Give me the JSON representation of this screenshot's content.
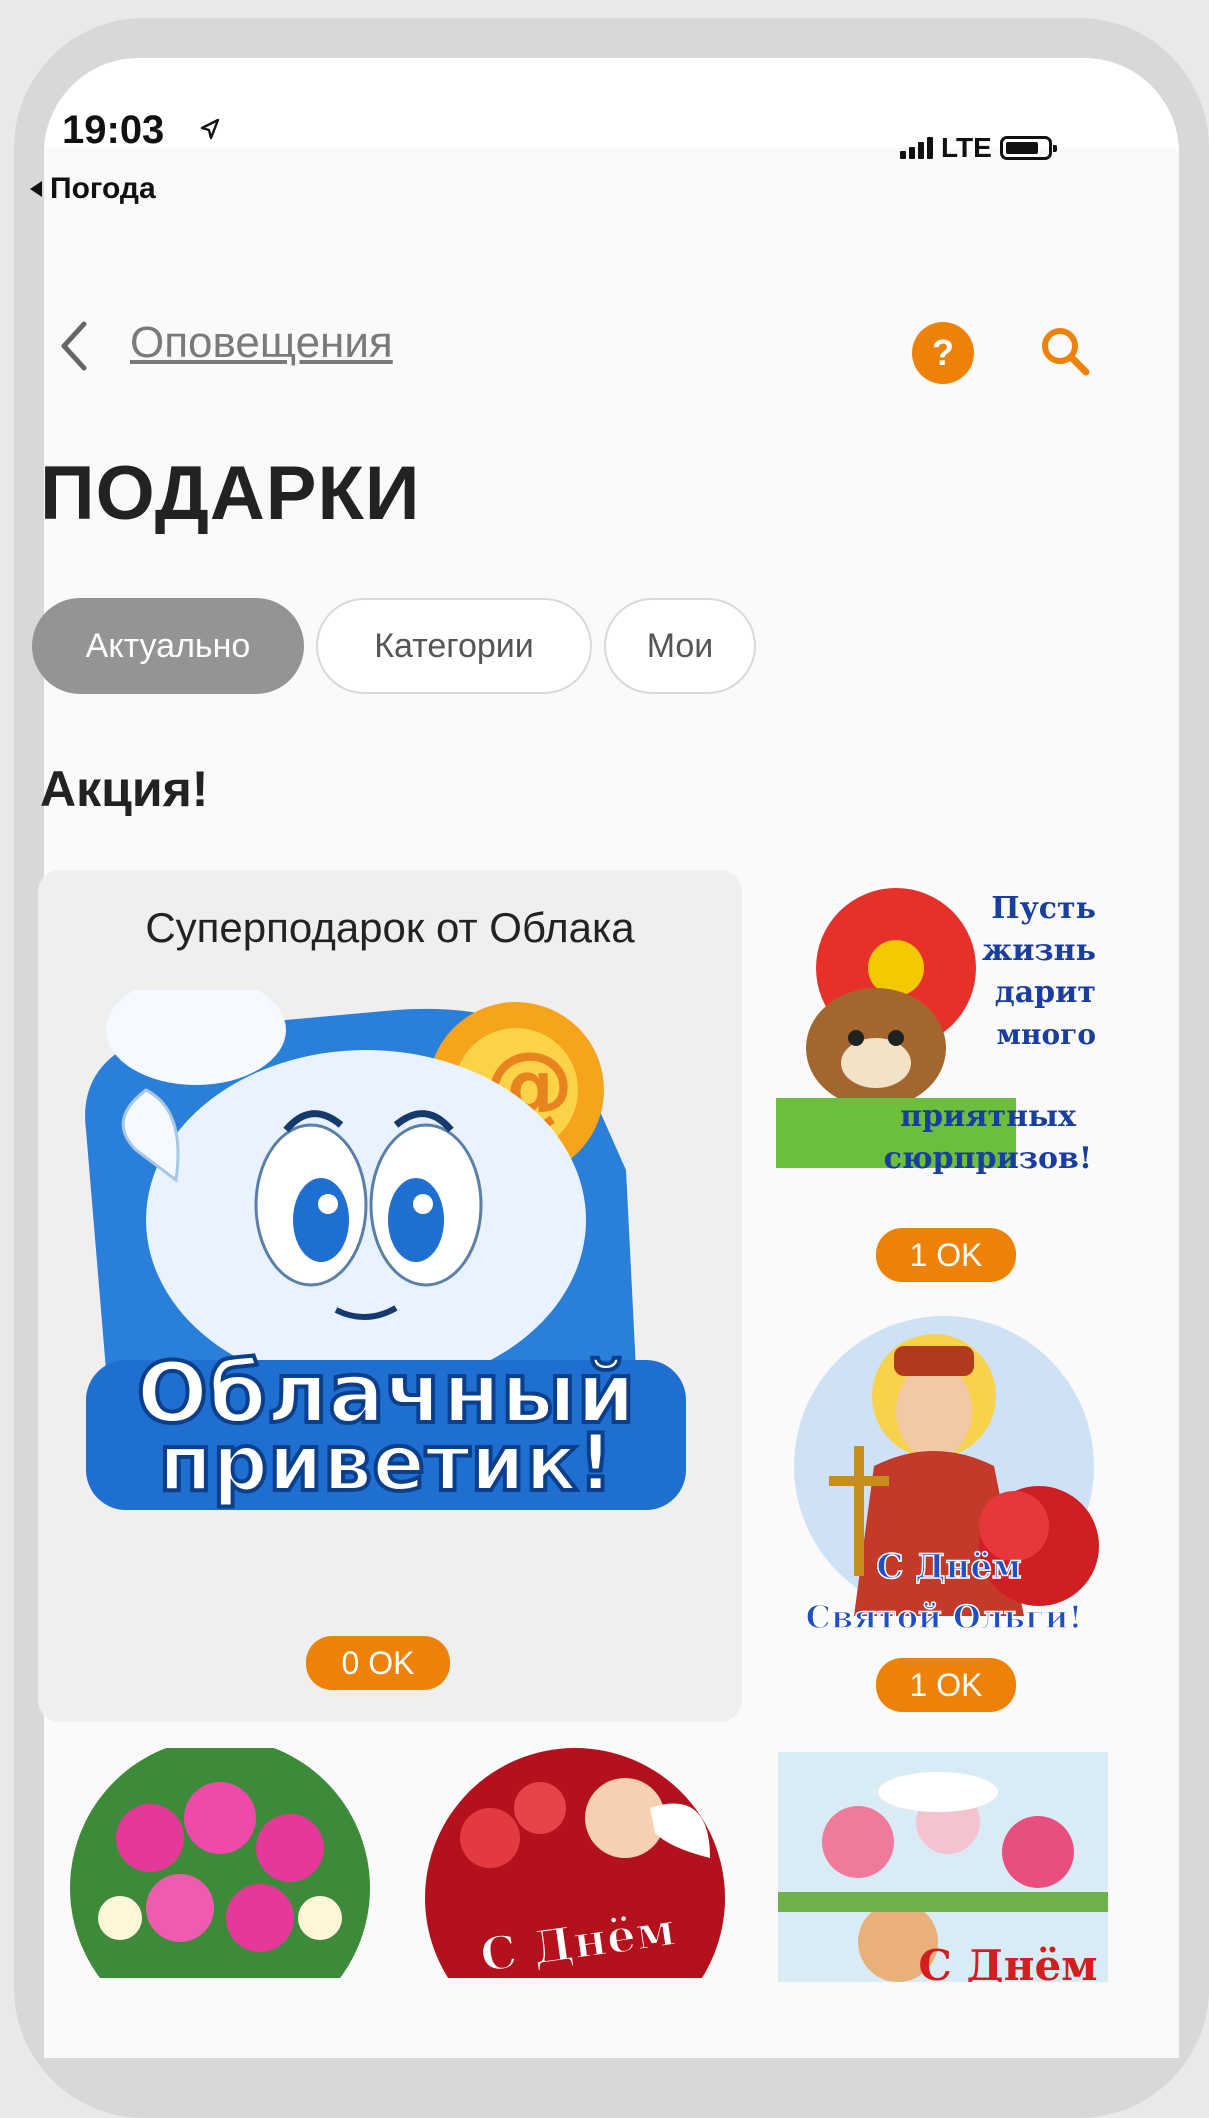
{
  "status_bar": {
    "time": "19:03",
    "back_app": "Погода",
    "network": "LTE"
  },
  "nav": {
    "back_label": "Оповещения"
  },
  "page": {
    "title": "ПОДАРКИ"
  },
  "tabs": [
    {
      "label": "Актуально",
      "active": true
    },
    {
      "label": "Категории",
      "active": false
    },
    {
      "label": "Мои",
      "active": false
    }
  ],
  "section": {
    "title": "Акция!"
  },
  "promo": {
    "name": "Суперподарок от Облака",
    "art_text_1": "Облачный",
    "art_text_2": "приветик!",
    "price": "0 OK"
  },
  "gifts": [
    {
      "lines": [
        "Пусть",
        "жизнь",
        "дарит",
        "много",
        "приятных",
        "сюрпризов!"
      ],
      "price": "1 OK"
    },
    {
      "lines": [
        "С Днём",
        "Святой Ольги!"
      ],
      "price": "1 OK"
    },
    {
      "lines": []
    },
    {
      "lines": [
        "С Днём"
      ]
    },
    {
      "lines": [
        "С Днём"
      ]
    }
  ],
  "colors": {
    "accent": "#ee8208",
    "tab_active": "#949494"
  }
}
